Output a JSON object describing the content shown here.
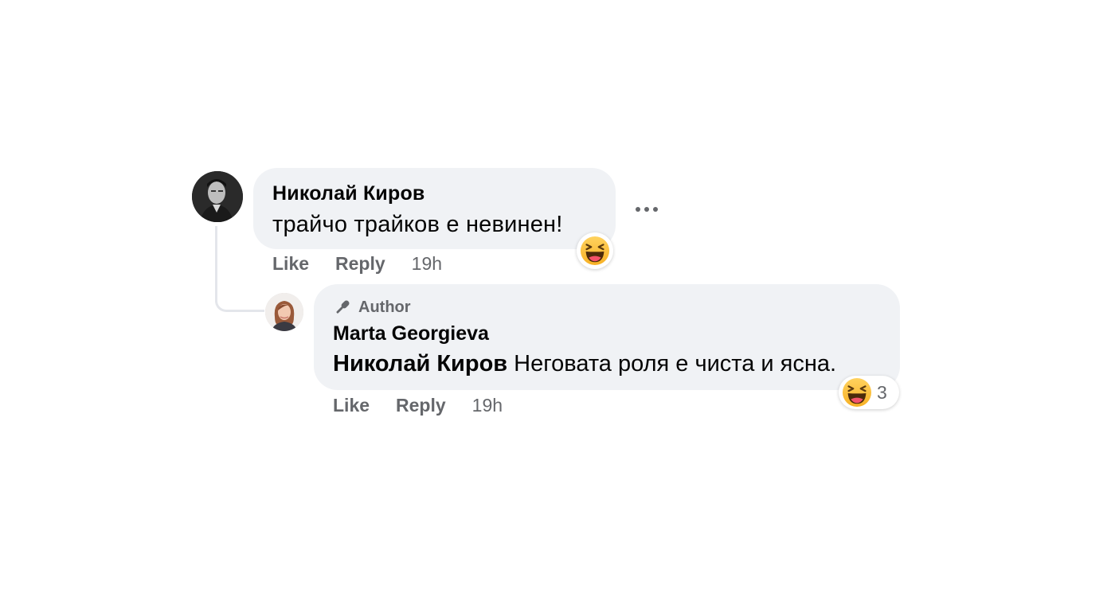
{
  "comment": {
    "author": "Николай Киров",
    "text": "трайчо трайков е невинен!",
    "actions": {
      "like": "Like",
      "reply": "Reply",
      "time": "19h"
    },
    "reaction_icon": "haha-emoji-icon"
  },
  "reply": {
    "badge": "Author",
    "badge_icon": "microphone-icon",
    "author": "Marta Georgieva",
    "mention": "Николай Киров",
    "text": "Неговата роля е чиста и ясна.",
    "actions": {
      "like": "Like",
      "reply": "Reply",
      "time": "19h"
    },
    "reaction_icon": "haha-emoji-icon",
    "reaction_count": "3"
  },
  "more_icon": "more-options-icon",
  "colors": {
    "bubble": "#f0f2f5",
    "secondary_text": "#65676b",
    "primary_text": "#050505",
    "connector": "#e4e6eb"
  }
}
